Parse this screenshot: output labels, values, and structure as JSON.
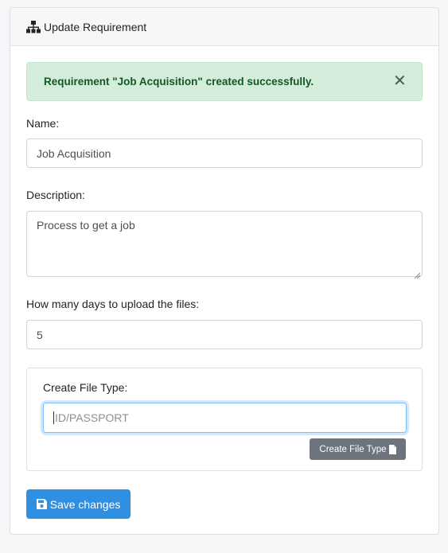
{
  "header": {
    "title": "Update Requirement",
    "icon": "sitemap-icon"
  },
  "alert": {
    "message": "Requirement \"Job Acquisition\" created successfully.",
    "close_symbol": "✕",
    "color": "#d4edda"
  },
  "form": {
    "name": {
      "label": "Name:",
      "value": "Job Acquisition"
    },
    "description": {
      "label": "Description:",
      "value": "Process to get a job"
    },
    "days": {
      "label": "How many days to upload the files:",
      "value": "5"
    }
  },
  "file_type": {
    "label": "Create File Type:",
    "placeholder": "ID/PASSPORT",
    "button_label": "Create File Type",
    "button_icon": "file-icon"
  },
  "save": {
    "label": "Save changes",
    "icon": "floppy-disk-icon",
    "color": "#2f8fe0"
  }
}
